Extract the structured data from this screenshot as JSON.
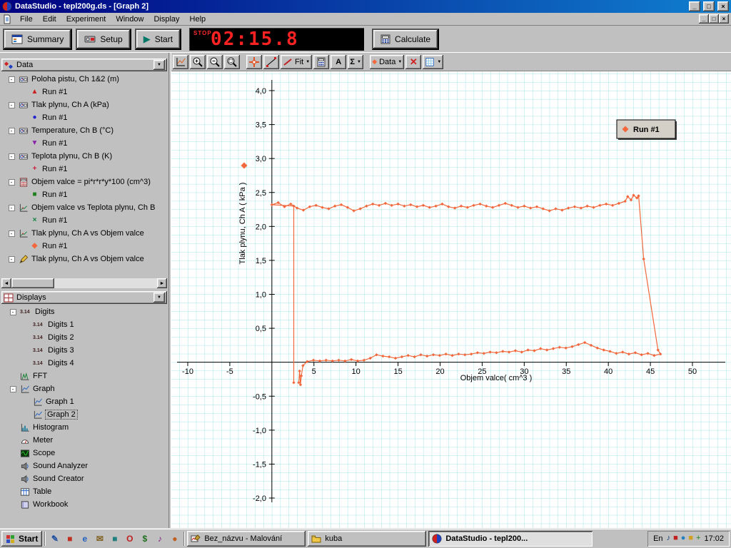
{
  "window": {
    "title": "DataStudio - tepl200g.ds - [Graph 2]",
    "controls": [
      "minimize",
      "maximize",
      "close"
    ]
  },
  "menu": {
    "items": [
      "File",
      "Edit",
      "Experiment",
      "Window",
      "Display",
      "Help"
    ]
  },
  "toolbar": {
    "summary": "Summary",
    "setup": "Setup",
    "start": "Start",
    "stop_label": "STOP",
    "timer": "02:15.8",
    "calculate": "Calculate"
  },
  "graph_toolbar": {
    "fit": "Fit",
    "data": "Data",
    "sigma": "Σ",
    "annotate": "A"
  },
  "data_panel": {
    "header": "Data",
    "sources": [
      {
        "label": "Poloha pistu, Ch 1&2 (m)",
        "icon": "sensor",
        "run": "Run #1",
        "marker": "▲",
        "marker_color": "#cc2020"
      },
      {
        "label": "Tlak plynu, Ch A (kPa)",
        "icon": "sensor",
        "run": "Run #1",
        "marker": "●",
        "marker_color": "#2020cc"
      },
      {
        "label": "Temperature, Ch B (°C)",
        "icon": "sensor",
        "run": "Run #1",
        "marker": "▼",
        "marker_color": "#8820a8"
      },
      {
        "label": "Teplota plynu, Ch B (K)",
        "icon": "sensor",
        "run": "Run #1",
        "marker": "+",
        "marker_color": "#cc2040"
      },
      {
        "label": "Objem valce = pi*r*r*y*100 (cm^3)",
        "icon": "calc",
        "run": "Run #1",
        "marker": "■",
        "marker_color": "#208020"
      },
      {
        "label": "Objem valce vs Teplota plynu, Ch B",
        "icon": "vs",
        "run": "Run #1",
        "marker": "×",
        "marker_color": "#108040"
      },
      {
        "label": "Tlak plynu, Ch A vs Objem valce",
        "icon": "vs",
        "run": "Run #1",
        "marker": "◆",
        "marker_color": "#f2683c"
      },
      {
        "label": "Tlak plynu, Ch A vs Objem valce",
        "icon": "pen",
        "run": null
      }
    ]
  },
  "displays_panel": {
    "header": "Displays",
    "items": [
      {
        "label": "Digits",
        "icon": "digits",
        "indent": 0,
        "expand": true
      },
      {
        "label": "Digits 1",
        "icon": "digits",
        "indent": 1
      },
      {
        "label": "Digits 2",
        "icon": "digits",
        "indent": 1
      },
      {
        "label": "Digits 3",
        "icon": "digits",
        "indent": 1
      },
      {
        "label": "Digits 4",
        "icon": "digits",
        "indent": 1
      },
      {
        "label": "FFT",
        "icon": "fft",
        "indent": 0
      },
      {
        "label": "Graph",
        "icon": "graph",
        "indent": 0,
        "expand": true
      },
      {
        "label": "Graph 1",
        "icon": "graph",
        "indent": 1
      },
      {
        "label": "Graph 2",
        "icon": "graph",
        "indent": 1,
        "selected": true
      },
      {
        "label": "Histogram",
        "icon": "histogram",
        "indent": 0
      },
      {
        "label": "Meter",
        "icon": "meter",
        "indent": 0
      },
      {
        "label": "Scope",
        "icon": "scope",
        "indent": 0
      },
      {
        "label": "Sound Analyzer",
        "icon": "sound",
        "indent": 0
      },
      {
        "label": "Sound Creator",
        "icon": "sound",
        "indent": 0
      },
      {
        "label": "Table",
        "icon": "table",
        "indent": 0
      },
      {
        "label": "Workbook",
        "icon": "workbook",
        "indent": 0
      }
    ]
  },
  "chart_data": {
    "type": "scatter",
    "title": "",
    "xlabel": "Objem valce( cm^3 )",
    "ylabel": "Tlak plynu, Ch A ( kPa )",
    "legend_label": "Run #1",
    "legend_position": "top-right",
    "grid": true,
    "grid_color": "#a6e6e6",
    "xlim": [
      -12,
      54
    ],
    "ylim": [
      -2.5,
      4.3
    ],
    "x_ticks": [
      {
        "v": -10,
        "label": "-10"
      },
      {
        "v": -5,
        "label": "-5"
      },
      {
        "v": 5,
        "label": "5"
      },
      {
        "v": 10,
        "label": "10"
      },
      {
        "v": 15,
        "label": "15"
      },
      {
        "v": 20,
        "label": "20"
      },
      {
        "v": 25,
        "label": "25"
      },
      {
        "v": 30,
        "label": "30"
      },
      {
        "v": 35,
        "label": "35"
      },
      {
        "v": 40,
        "label": "40"
      },
      {
        "v": 45,
        "label": "45"
      },
      {
        "v": 50,
        "label": "50"
      }
    ],
    "y_ticks": [
      {
        "v": 4,
        "label": "4,0"
      },
      {
        "v": 3.5,
        "label": "3,5"
      },
      {
        "v": 3,
        "label": "3,0"
      },
      {
        "v": 2.5,
        "label": "2,5"
      },
      {
        "v": 2,
        "label": "2,0"
      },
      {
        "v": 1.5,
        "label": "1,5"
      },
      {
        "v": 1,
        "label": "1,0"
      },
      {
        "v": 0.5,
        "label": "0,5"
      },
      {
        "v": -0.5,
        "label": "-0,5"
      },
      {
        "v": -1,
        "label": "-1,0"
      },
      {
        "v": -1.5,
        "label": "-1,5"
      },
      {
        "v": -2,
        "label": "-2,0"
      }
    ],
    "series": [
      {
        "name": "Run #1",
        "color": "#f2683c",
        "points": [
          [
            2.6,
            -0.3
          ],
          [
            2.6,
            2.3
          ],
          [
            0,
            2.32
          ],
          [
            0.75,
            2.35
          ],
          [
            1.5,
            2.29
          ],
          [
            2.25,
            2.33
          ],
          [
            3,
            2.27
          ],
          [
            3.75,
            2.24
          ],
          [
            4.5,
            2.29
          ],
          [
            5.25,
            2.31
          ],
          [
            6,
            2.28
          ],
          [
            6.75,
            2.26
          ],
          [
            7.5,
            2.3
          ],
          [
            8.25,
            2.32
          ],
          [
            9,
            2.28
          ],
          [
            9.75,
            2.23
          ],
          [
            10.5,
            2.26
          ],
          [
            11.25,
            2.3
          ],
          [
            12,
            2.33
          ],
          [
            12.75,
            2.31
          ],
          [
            13.5,
            2.34
          ],
          [
            14.25,
            2.31
          ],
          [
            15,
            2.33
          ],
          [
            15.75,
            2.3
          ],
          [
            16.5,
            2.32
          ],
          [
            17.25,
            2.29
          ],
          [
            18,
            2.31
          ],
          [
            18.75,
            2.28
          ],
          [
            19.5,
            2.3
          ],
          [
            20.25,
            2.33
          ],
          [
            21,
            2.29
          ],
          [
            21.75,
            2.27
          ],
          [
            22.5,
            2.3
          ],
          [
            23.25,
            2.28
          ],
          [
            24,
            2.31
          ],
          [
            24.75,
            2.33
          ],
          [
            25.5,
            2.3
          ],
          [
            26.25,
            2.28
          ],
          [
            27,
            2.31
          ],
          [
            27.75,
            2.34
          ],
          [
            28.5,
            2.31
          ],
          [
            29.25,
            2.28
          ],
          [
            30,
            2.3
          ],
          [
            30.75,
            2.27
          ],
          [
            31.5,
            2.29
          ],
          [
            32.25,
            2.26
          ],
          [
            33,
            2.23
          ],
          [
            33.75,
            2.26
          ],
          [
            34.5,
            2.24
          ],
          [
            35.25,
            2.27
          ],
          [
            36,
            2.29
          ],
          [
            36.75,
            2.27
          ],
          [
            37.5,
            2.3
          ],
          [
            38.25,
            2.28
          ],
          [
            39,
            2.31
          ],
          [
            39.75,
            2.33
          ],
          [
            40.5,
            2.31
          ],
          [
            41.25,
            2.34
          ],
          [
            42,
            2.37
          ],
          [
            42.3,
            2.44
          ],
          [
            42.7,
            2.39
          ],
          [
            43,
            2.46
          ],
          [
            43.4,
            2.42
          ],
          [
            43.6,
            2.45
          ],
          [
            44.2,
            1.52
          ],
          [
            45.9,
            0.18
          ],
          [
            46.2,
            0.12
          ],
          [
            45.45,
            0.1
          ],
          [
            44.7,
            0.13
          ],
          [
            43.95,
            0.11
          ],
          [
            43.2,
            0.14
          ],
          [
            42.45,
            0.12
          ],
          [
            41.7,
            0.15
          ],
          [
            40.95,
            0.13
          ],
          [
            40.2,
            0.16
          ],
          [
            39.45,
            0.18
          ],
          [
            38.7,
            0.21
          ],
          [
            37.95,
            0.25
          ],
          [
            37.2,
            0.29
          ],
          [
            36.45,
            0.26
          ],
          [
            35.7,
            0.23
          ],
          [
            34.95,
            0.21
          ],
          [
            34.2,
            0.22
          ],
          [
            33.45,
            0.2
          ],
          [
            32.7,
            0.18
          ],
          [
            31.95,
            0.2
          ],
          [
            31.2,
            0.17
          ],
          [
            30.45,
            0.18
          ],
          [
            29.7,
            0.15
          ],
          [
            28.95,
            0.17
          ],
          [
            28.2,
            0.15
          ],
          [
            27.45,
            0.16
          ],
          [
            26.7,
            0.14
          ],
          [
            25.95,
            0.15
          ],
          [
            25.2,
            0.13
          ],
          [
            24.45,
            0.14
          ],
          [
            23.7,
            0.12
          ],
          [
            22.95,
            0.11
          ],
          [
            22.2,
            0.12
          ],
          [
            21.45,
            0.1
          ],
          [
            20.7,
            0.12
          ],
          [
            19.95,
            0.1
          ],
          [
            19.2,
            0.11
          ],
          [
            18.45,
            0.09
          ],
          [
            17.7,
            0.11
          ],
          [
            16.95,
            0.08
          ],
          [
            16.2,
            0.1
          ],
          [
            15.45,
            0.08
          ],
          [
            14.7,
            0.06
          ],
          [
            13.95,
            0.08
          ],
          [
            13.2,
            0.09
          ],
          [
            12.45,
            0.11
          ],
          [
            11.7,
            0.06
          ],
          [
            10.95,
            0.03
          ],
          [
            10.2,
            0.02
          ],
          [
            9.45,
            0.04
          ],
          [
            8.7,
            0.02
          ],
          [
            7.95,
            0.03
          ],
          [
            7.2,
            0.02
          ],
          [
            6.45,
            0.03
          ],
          [
            5.7,
            0.02
          ],
          [
            4.95,
            0.03
          ],
          [
            4.2,
            0.01
          ],
          [
            3.7,
            -0.05
          ],
          [
            3.5,
            -0.2
          ],
          [
            3.4,
            -0.33
          ],
          [
            3.3,
            -0.13
          ],
          [
            3.2,
            -0.3
          ]
        ]
      }
    ]
  },
  "taskbar": {
    "start": "Start",
    "quick_launch": [
      {
        "name": "pen-icon",
        "glyph": "✎",
        "color": "#2050a0"
      },
      {
        "name": "red-app-icon",
        "glyph": "■",
        "color": "#c03020"
      },
      {
        "name": "ie-icon",
        "glyph": "e",
        "color": "#2060c0"
      },
      {
        "name": "mail-icon",
        "glyph": "✉",
        "color": "#806020"
      },
      {
        "name": "desktop-icon",
        "glyph": "■",
        "color": "#208080"
      },
      {
        "name": "o-app-icon",
        "glyph": "O",
        "color": "#c02020"
      },
      {
        "name": "money-icon",
        "glyph": "$",
        "color": "#207020"
      },
      {
        "name": "media-icon",
        "glyph": "♪",
        "color": "#802080"
      },
      {
        "name": "globe-icon",
        "glyph": "●",
        "color": "#c06020"
      }
    ],
    "tasks": [
      {
        "label": "Bez_názvu - Malování",
        "icon": "paint",
        "active": false
      },
      {
        "label": "kuba",
        "icon": "folder",
        "active": false
      },
      {
        "label": "DataStudio - tepl200...",
        "icon": "datastudio",
        "active": true
      }
    ],
    "tray": {
      "lang": "En",
      "icons": [
        {
          "name": "volume-icon",
          "glyph": "♪",
          "color": "#204080"
        },
        {
          "name": "tray-red-icon",
          "glyph": "■",
          "color": "#c02020"
        },
        {
          "name": "tray-blue-icon",
          "glyph": "●",
          "color": "#2080c0"
        },
        {
          "name": "tray-yellow-icon",
          "glyph": "■",
          "color": "#d0a020"
        },
        {
          "name": "tray-green-icon",
          "glyph": "+",
          "color": "#208020"
        }
      ],
      "clock": "17:02"
    }
  }
}
